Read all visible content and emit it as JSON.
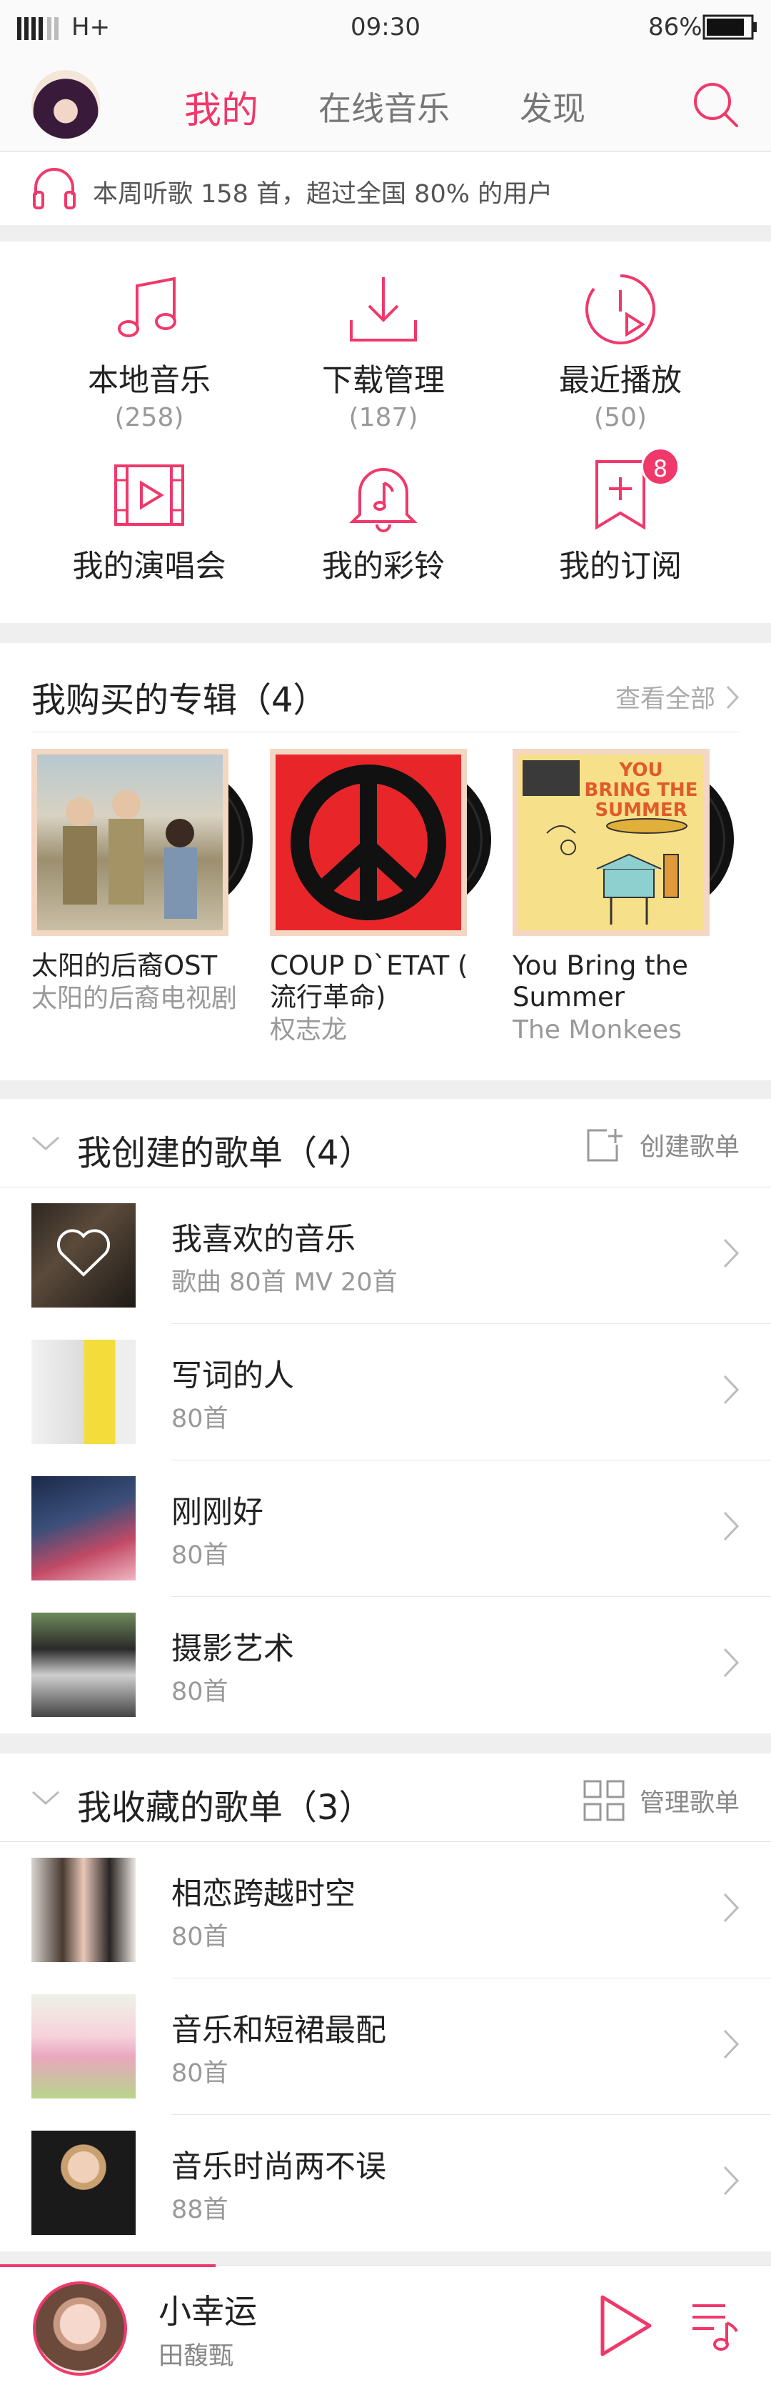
{
  "status_bar": {
    "network": "H+",
    "time": "09:30",
    "battery": "86%"
  },
  "header": {
    "tabs": [
      {
        "label": "我的",
        "active": true
      },
      {
        "label": "在线音乐",
        "active": false
      },
      {
        "label": "发现",
        "active": false
      }
    ],
    "icons": {
      "search": "search-icon",
      "avatar": "avatar"
    }
  },
  "stats": {
    "text": "本周听歌 158 首，超过全国 80% 的用户",
    "icon": "headphones-icon"
  },
  "grid": [
    {
      "label": "本地音乐",
      "count": "(258)",
      "icon": "music-note-icon"
    },
    {
      "label": "下载管理",
      "count": "(187)",
      "icon": "download-icon"
    },
    {
      "label": "最近播放",
      "count": "(50)",
      "icon": "recent-play-icon"
    },
    {
      "label": "我的演唱会",
      "count": "",
      "icon": "film-play-icon"
    },
    {
      "label": "我的彩铃",
      "count": "",
      "icon": "bell-music-icon"
    },
    {
      "label": "我的订阅",
      "count": "",
      "icon": "bookmark-add-icon",
      "badge": "8"
    }
  ],
  "albums": {
    "title": "我购买的专辑（4）",
    "see_all": "查看全部",
    "items": [
      {
        "title": "太阳的后裔OST",
        "artist": "太阳的后裔电视剧"
      },
      {
        "title": "COUP D`ETAT ( 流行革命)",
        "artist": "权志龙"
      },
      {
        "title": "You Bring the Summer",
        "artist": "The Monkees",
        "cover_text": "YOU BRING THE SUMMER"
      }
    ]
  },
  "created": {
    "title": "我创建的歌单（4）",
    "action": "创建歌单",
    "items": [
      {
        "name": "我喜欢的音乐",
        "sub": "歌曲 80首    MV 20首"
      },
      {
        "name": "写词的人",
        "sub": "80首"
      },
      {
        "name": "刚刚好",
        "sub": "80首"
      },
      {
        "name": "摄影艺术",
        "sub": "80首"
      }
    ]
  },
  "collected": {
    "title": "我收藏的歌单（3）",
    "action": "管理歌单",
    "items": [
      {
        "name": "相恋跨越时空",
        "sub": "80首"
      },
      {
        "name": "音乐和短裙最配",
        "sub": "80首"
      },
      {
        "name": "音乐时尚两不误",
        "sub": "88首"
      }
    ]
  },
  "player": {
    "song": "小幸运",
    "artist": "田馥甄",
    "progress_percent": 28
  },
  "colors": {
    "accent": "#f0386b",
    "text": "#222222",
    "muted": "#999999",
    "bg": "#efefef"
  }
}
